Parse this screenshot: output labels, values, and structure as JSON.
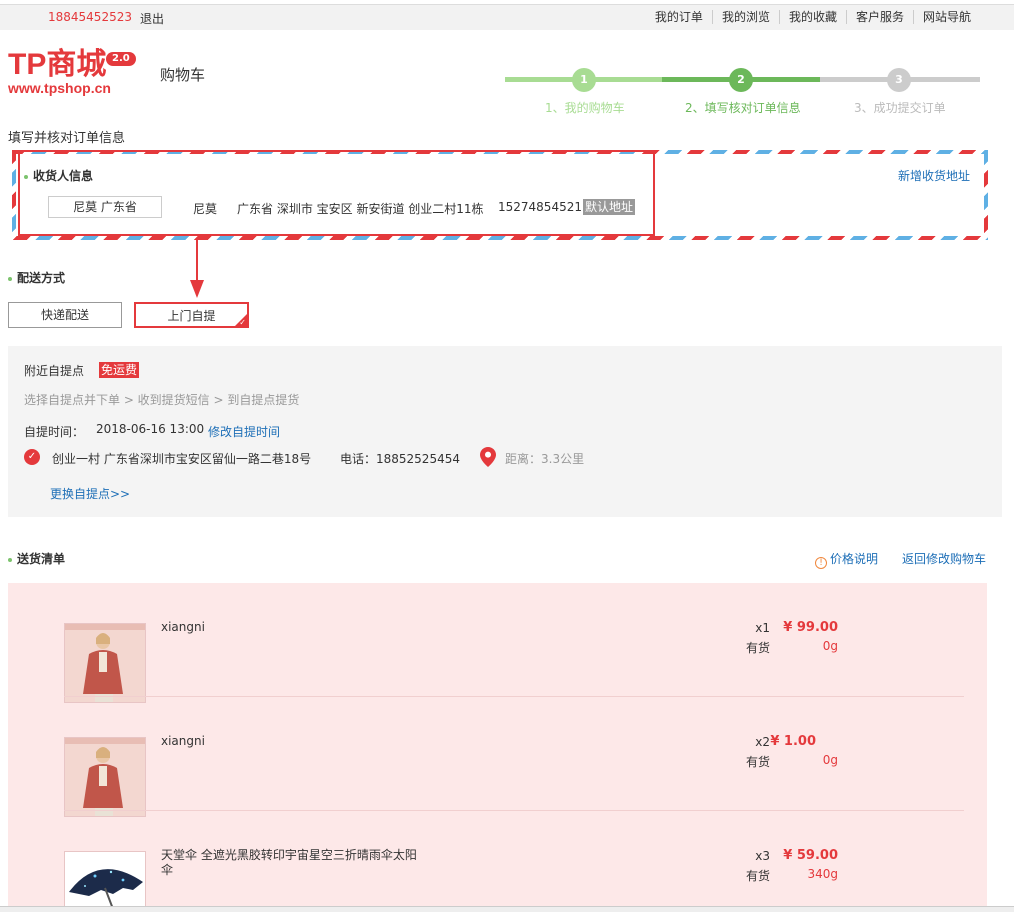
{
  "topbar": {
    "phone": "18845452523",
    "logout": "退出",
    "nav": [
      "我的订单",
      "我的浏览",
      "我的收藏",
      "客户服务",
      "网站导航"
    ]
  },
  "logo": {
    "brand": "TP商城",
    "version": "2.0",
    "url": "www.tpshop.cn"
  },
  "page_title": "购物车",
  "steps": [
    {
      "num": "1",
      "label": "1、我的购物车"
    },
    {
      "num": "2",
      "label": "2、填写核对订单信息"
    },
    {
      "num": "3",
      "label": "3、成功提交订单"
    }
  ],
  "colors": {
    "accent": "#e4393c",
    "step_light": "#a8dc93",
    "step_active": "#6cb85a",
    "step_inactive": "#cccccc",
    "link": "#1e6fb7"
  },
  "section_label": "填写并核对订单信息",
  "address": {
    "title": "收货人信息",
    "add_label": "新增收货地址",
    "name_tag": "尼莫 广东省",
    "name": "尼莫",
    "detail": "广东省 深圳市 宝安区 新安街道 创业二村11栋",
    "phone": "15274854521",
    "default_badge": "默认地址"
  },
  "shipping": {
    "title": "配送方式",
    "option_express": "快递配送",
    "option_pickup": "上门自提"
  },
  "pickup": {
    "nearby": "附近自提点",
    "free_badge": "免运费",
    "steps_text": "选择自提点并下单 > 收到提货短信 > 到自提点提货",
    "time_label": "自提时间：",
    "time_value": "2018-06-16 13:00",
    "modify_time": "修改自提时间",
    "point_address": "创业一村 广东省深圳市宝安区留仙一路二巷18号",
    "point_phone": "电话：18852525454",
    "distance": "距离：3.3公里",
    "change_point": "更换自提点>>"
  },
  "delivery": {
    "title": "送货清单",
    "price_note": "价格说明",
    "back_to_cart": "返回修改购物车",
    "items": [
      {
        "name": "xiangni",
        "qty": "x1",
        "stock": "有货",
        "price": "¥ 99.00",
        "weight": "0g",
        "image": "coat-image"
      },
      {
        "name": "xiangni",
        "qty": "x2",
        "stock": "有货",
        "price": "¥ 1.00",
        "weight": "0g",
        "image": "coat-image"
      },
      {
        "name": "天堂伞 全遮光黑胶转印宇宙星空三折晴雨伞太阳伞",
        "qty": "x3",
        "stock": "有货",
        "price": "¥ 59.00",
        "weight": "340g",
        "image": "umbrella-image"
      }
    ]
  }
}
